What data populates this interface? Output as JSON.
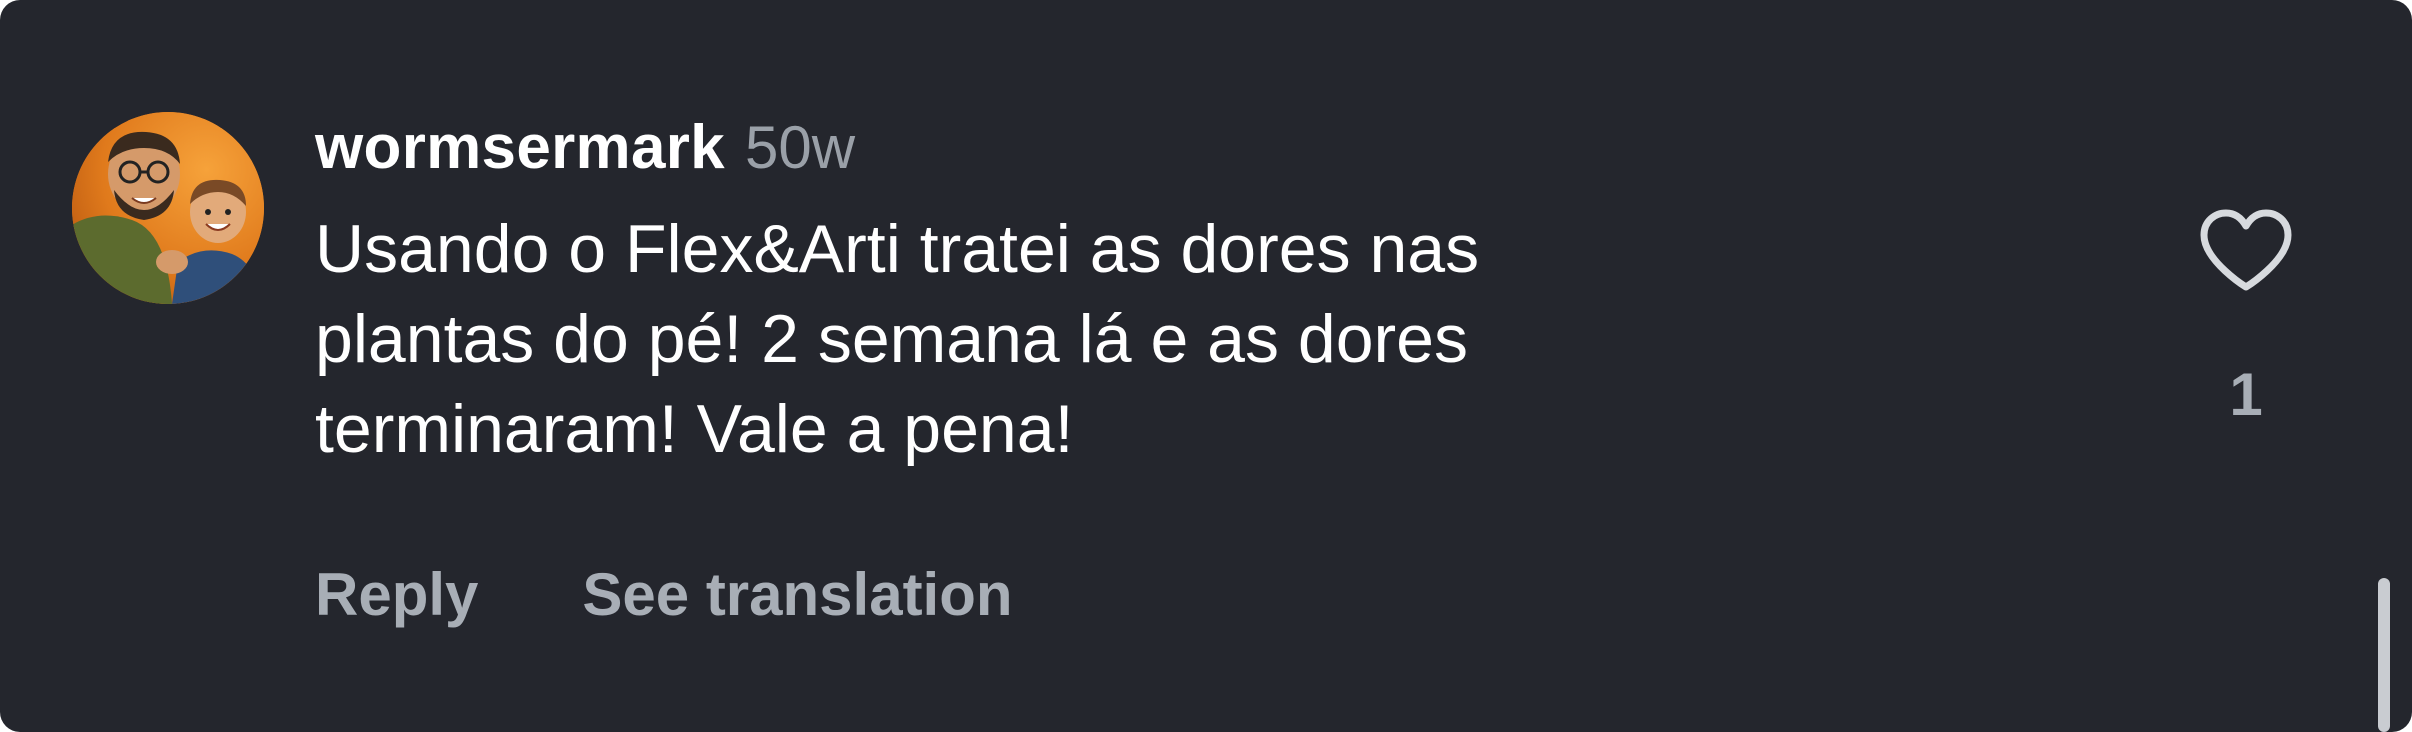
{
  "comment": {
    "username": "wormsermark",
    "timestamp": "50w",
    "text": "Usando o Flex&Arti tratei as dores nas\nplantas do pé! 2 semana lá e as dores\nterminaram! Vale a pena!",
    "like_count": "1"
  },
  "actions": {
    "reply_label": "Reply",
    "translate_label": "See translation"
  },
  "icons": {
    "like": "heart-outline-icon",
    "avatar": "user-avatar"
  },
  "colors": {
    "background": "#24262d",
    "primary_text": "#ffffff",
    "secondary_text": "#a8aeb6"
  }
}
